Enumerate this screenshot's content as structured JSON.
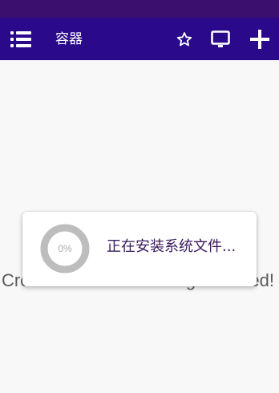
{
  "app_bar": {
    "title": "容器",
    "menu_icon": "list-menu-icon",
    "actions": [
      {
        "icon": "star-outline-icon"
      },
      {
        "icon": "monitor-icon"
      },
      {
        "icon": "plus-icon"
      }
    ],
    "color": "#2a0a8a"
  },
  "status_bar": {
    "color": "#3a0f6e"
  },
  "background": {
    "message": "Create a container and get started!"
  },
  "install_dialog": {
    "progress_percent": 0,
    "progress_label": "0%",
    "message": "正在安装系统文件..."
  },
  "colors": {
    "accent": "#2a0a8a",
    "dialog_text": "#3a1a5e",
    "ring_track": "#bdbdbd"
  }
}
